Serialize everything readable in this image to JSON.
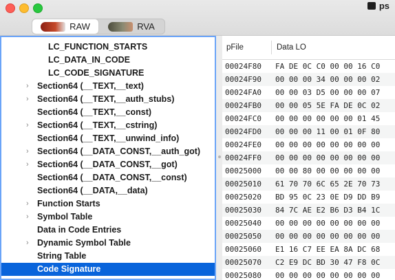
{
  "window": {
    "title": "ps",
    "segments": [
      {
        "label": "RAW",
        "active": true
      },
      {
        "label": "RVA",
        "active": false
      }
    ]
  },
  "tree": {
    "rows": [
      {
        "label": "LC_FUNCTION_STARTS",
        "indent": 2,
        "expandable": false
      },
      {
        "label": "LC_DATA_IN_CODE",
        "indent": 2,
        "expandable": false
      },
      {
        "label": "LC_CODE_SIGNATURE",
        "indent": 2,
        "expandable": false
      },
      {
        "label": "Section64 (__TEXT,__text)",
        "indent": 1,
        "expandable": true
      },
      {
        "label": "Section64 (__TEXT,__auth_stubs)",
        "indent": 1,
        "expandable": true
      },
      {
        "label": "Section64 (__TEXT,__const)",
        "indent": 1,
        "expandable": false
      },
      {
        "label": "Section64 (__TEXT,__cstring)",
        "indent": 1,
        "expandable": true
      },
      {
        "label": "Section64 (__TEXT,__unwind_info)",
        "indent": 1,
        "expandable": false
      },
      {
        "label": "Section64 (__DATA_CONST,__auth_got)",
        "indent": 1,
        "expandable": true
      },
      {
        "label": "Section64 (__DATA_CONST,__got)",
        "indent": 1,
        "expandable": true
      },
      {
        "label": "Section64 (__DATA_CONST,__const)",
        "indent": 1,
        "expandable": false
      },
      {
        "label": "Section64 (__DATA,__data)",
        "indent": 1,
        "expandable": false
      },
      {
        "label": "Function Starts",
        "indent": 1,
        "expandable": true
      },
      {
        "label": "Symbol Table",
        "indent": 1,
        "expandable": true
      },
      {
        "label": "Data in Code Entries",
        "indent": 1,
        "expandable": false
      },
      {
        "label": "Dynamic Symbol Table",
        "indent": 1,
        "expandable": true
      },
      {
        "label": "String Table",
        "indent": 1,
        "expandable": false
      },
      {
        "label": "Code Signature",
        "indent": 1,
        "expandable": false,
        "selected": true
      }
    ]
  },
  "table": {
    "headers": {
      "offset": "pFile",
      "data": "Data LO"
    },
    "rows": [
      {
        "offset": "00024F80",
        "bytes": "FA DE 0C C0 00 00 16 C0"
      },
      {
        "offset": "00024F90",
        "bytes": "00 00 00 34 00 00 00 02"
      },
      {
        "offset": "00024FA0",
        "bytes": "00 00 03 D5 00 00 00 07"
      },
      {
        "offset": "00024FB0",
        "bytes": "00 00 05 5E FA DE 0C 02"
      },
      {
        "offset": "00024FC0",
        "bytes": "00 00 00 00 00 00 01 45"
      },
      {
        "offset": "00024FD0",
        "bytes": "00 00 00 11 00 01 0F 80"
      },
      {
        "offset": "00024FE0",
        "bytes": "00 00 00 00 00 00 00 00"
      },
      {
        "offset": "00024FF0",
        "bytes": "00 00 00 00 00 00 00 00"
      },
      {
        "offset": "00025000",
        "bytes": "00 00 80 00 00 00 00 00"
      },
      {
        "offset": "00025010",
        "bytes": "61 70 70 6C 65 2E 70 73"
      },
      {
        "offset": "00025020",
        "bytes": "BD 95 0C 23 0E D9 DD B9"
      },
      {
        "offset": "00025030",
        "bytes": "84 7C AE E2 B6 D3 B4 1C"
      },
      {
        "offset": "00025040",
        "bytes": "00 00 00 00 00 00 00 00"
      },
      {
        "offset": "00025050",
        "bytes": "00 00 00 00 00 00 00 00"
      },
      {
        "offset": "00025060",
        "bytes": "E1 16 C7 EE EA 8A DC 68"
      },
      {
        "offset": "00025070",
        "bytes": "C2 E9 DC BD 30 47 F8 0C"
      },
      {
        "offset": "00025080",
        "bytes": "00 00 00 00 00 00 00 00"
      }
    ]
  }
}
